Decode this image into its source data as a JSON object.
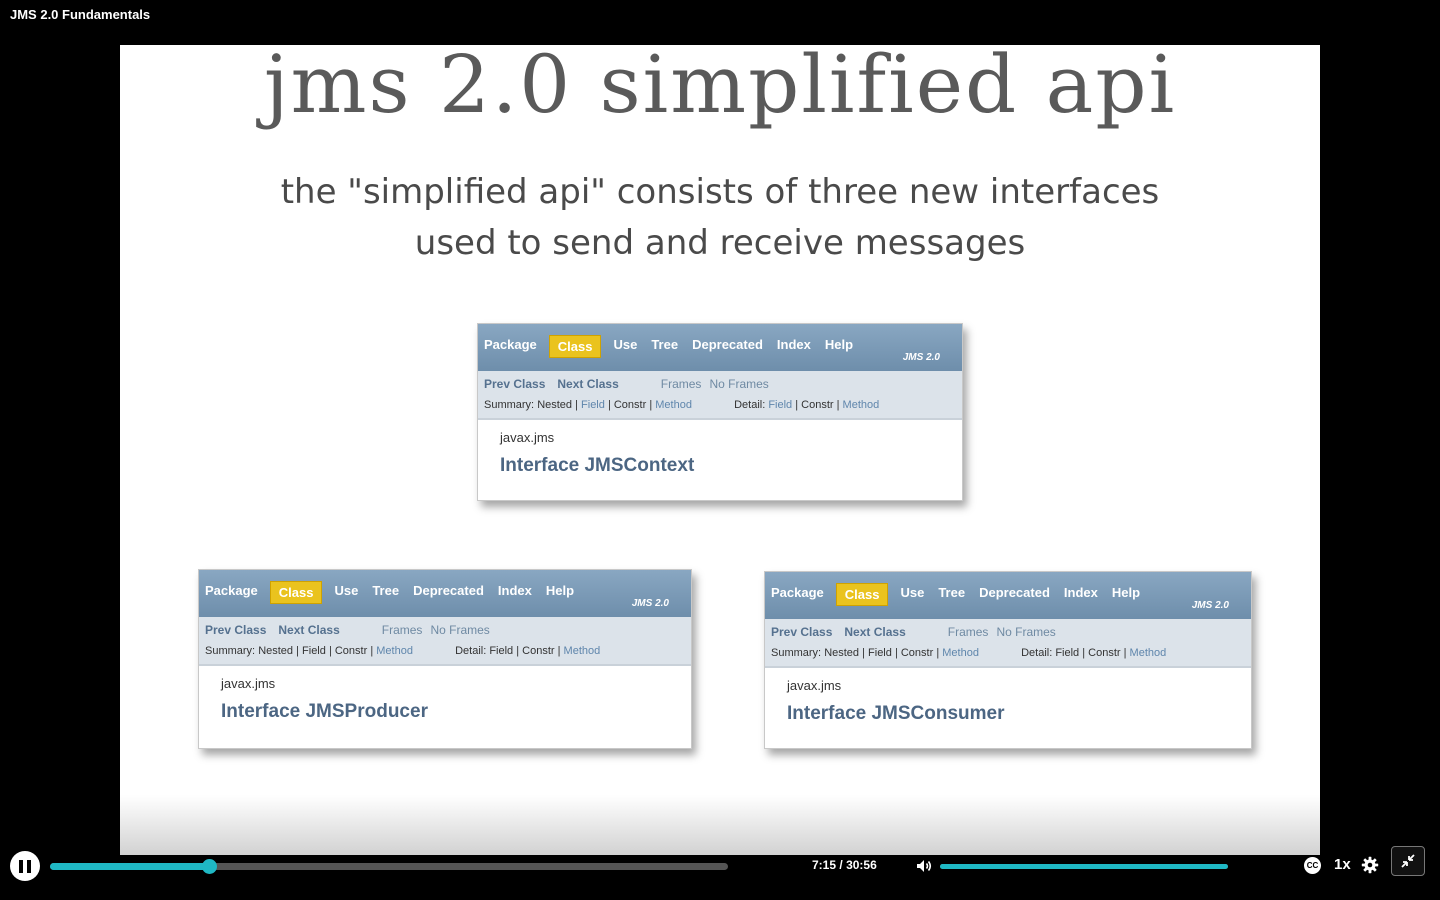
{
  "window": {
    "title": "JMS 2.0 Fundamentals"
  },
  "slide": {
    "title": "jms 2.0 simplified api",
    "subtitle_line1": "the \"simplified api\" consists of three new interfaces",
    "subtitle_line2": "used to send and receive messages"
  },
  "javadoc_common": {
    "nav": [
      "Package",
      "Class",
      "Use",
      "Tree",
      "Deprecated",
      "Index",
      "Help"
    ],
    "brand": "JMS 2.0",
    "prev_class": "Prev Class",
    "next_class": "Next Class",
    "frames": "Frames",
    "no_frames": "No Frames",
    "summary_label": "Summary:",
    "nested": "Nested",
    "field": "Field",
    "constr": "Constr",
    "method": "Method",
    "detail_label": "Detail:",
    "sep": "|",
    "package": "javax.jms"
  },
  "cards": [
    {
      "interface": "Interface JMSContext"
    },
    {
      "interface": "Interface JMSProducer"
    },
    {
      "interface": "Interface JMSConsumer"
    }
  ],
  "player": {
    "current_time": "7:15",
    "duration": "30:56",
    "time_sep": "/",
    "progress_fraction": 0.2344,
    "volume_fraction": 1.0,
    "speed": "1x",
    "cc_label": "CC",
    "icons": [
      "pause-icon",
      "volume-icon",
      "closed-captions-icon",
      "gear-icon",
      "exit-fullscreen-icon"
    ],
    "accent_color": "#1fb8c4"
  }
}
